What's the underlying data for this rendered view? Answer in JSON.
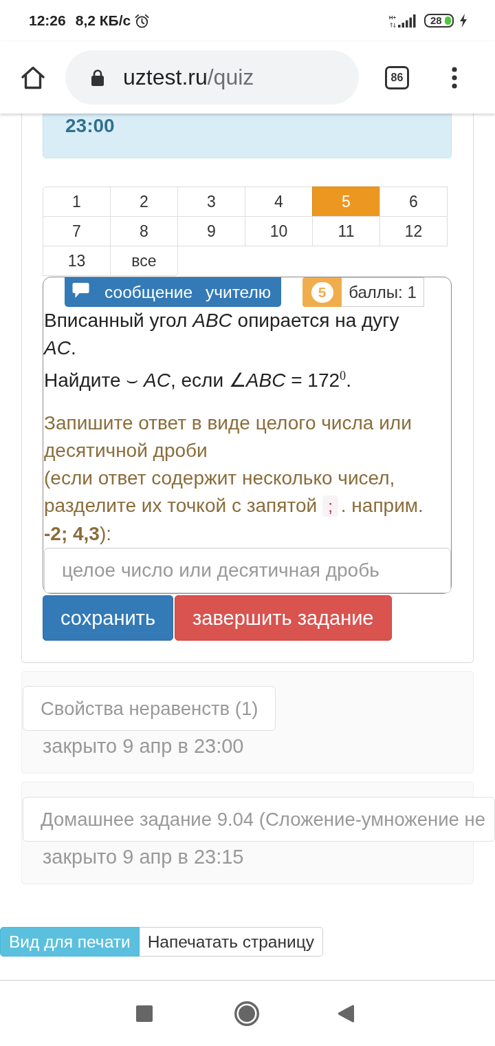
{
  "status_bar": {
    "time": "12:26",
    "speed": "8,2 КБ/с",
    "network": "H+",
    "battery": "28"
  },
  "browser": {
    "url_host": "uztest.ru",
    "url_path": "/quiz",
    "tab_count": "86"
  },
  "deadline_alert": {
    "text": "23:00"
  },
  "pagination": [
    {
      "label": "1",
      "selected": false
    },
    {
      "label": "2",
      "selected": false
    },
    {
      "label": "3",
      "selected": false
    },
    {
      "label": "4",
      "selected": false
    },
    {
      "label": "5",
      "selected": true
    },
    {
      "label": "6",
      "selected": false
    },
    {
      "label": "7",
      "selected": false
    },
    {
      "label": "8",
      "selected": false
    },
    {
      "label": "9",
      "selected": false
    },
    {
      "label": "10",
      "selected": false
    },
    {
      "label": "11",
      "selected": false
    },
    {
      "label": "12",
      "selected": false
    },
    {
      "label": "13",
      "selected": false
    },
    {
      "label": "все",
      "selected": false
    }
  ],
  "question": {
    "message_button": "сообщение учителю",
    "number": "5",
    "points": "баллы: 1",
    "text": [
      "Вписанный угол *ABC* опирается на дугу *AC*.",
      "Найдите ⌣ *AC*, если ∠*ABC* = 172$^{0}$."
    ],
    "format_hint": "Запишите ответ в виде целого числа или десятичной дроби",
    "separator_hint": {
      "before": "(если ответ содержит несколько чисел, разделите их точкой с запятой",
      "code": ";",
      "after": ". наприм. **-2; 4,3**):"
    },
    "answer": {
      "placeholder": "целое число или десятичная дробь"
    }
  },
  "actions": [
    {
      "label": "сохранить",
      "kind": "primary"
    },
    {
      "label": "завершить задание",
      "kind": "danger"
    }
  ],
  "assignments": [
    {
      "title": "Свойства неравенств (1)",
      "closed": "закрыто 9 апр в 23:00"
    },
    {
      "title": "Домашнее задание 9.04 (Сложение-умножение не",
      "closed": "закрыто 9 апр в 23:15"
    }
  ],
  "print_buttons": [
    {
      "label": "Вид для печати",
      "kind": "info"
    },
    {
      "label": "Напечатать страницу",
      "kind": "default"
    }
  ]
}
